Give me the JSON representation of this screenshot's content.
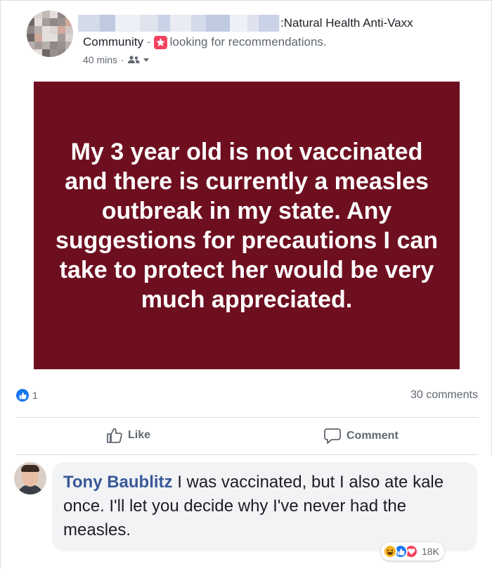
{
  "post": {
    "group_suffix": ":Natural Health Anti-Vaxx",
    "group_community": "Community",
    "separator": "-",
    "activity": "looking for recommendations.",
    "time": "40 mins",
    "time_dot": "·",
    "privacy_icon": "friends-icon",
    "image_text": "My 3 year old is not vaccinated and there is currently a measles outbreak in my state. Any suggestions for precautions I can take to protect her would be very much appreciated.",
    "image_bg": "#6e0f20"
  },
  "stats": {
    "like_count": "1",
    "comments_count": "30 comments"
  },
  "actions": {
    "like_label": "Like",
    "comment_label": "Comment"
  },
  "comment": {
    "author": "Tony Baublitz",
    "text": " I was vaccinated, but I also ate kale once. I'll let you decide why I've never had the measles.",
    "reaction_count": "18K",
    "reaction_icons": [
      "haha-icon",
      "like-icon",
      "love-icon"
    ]
  },
  "colors": {
    "brand_blue": "#1877f2",
    "link_blue": "#385898",
    "muted": "#606770",
    "love_red": "#f33e58",
    "haha_yellow": "#f7b125"
  }
}
